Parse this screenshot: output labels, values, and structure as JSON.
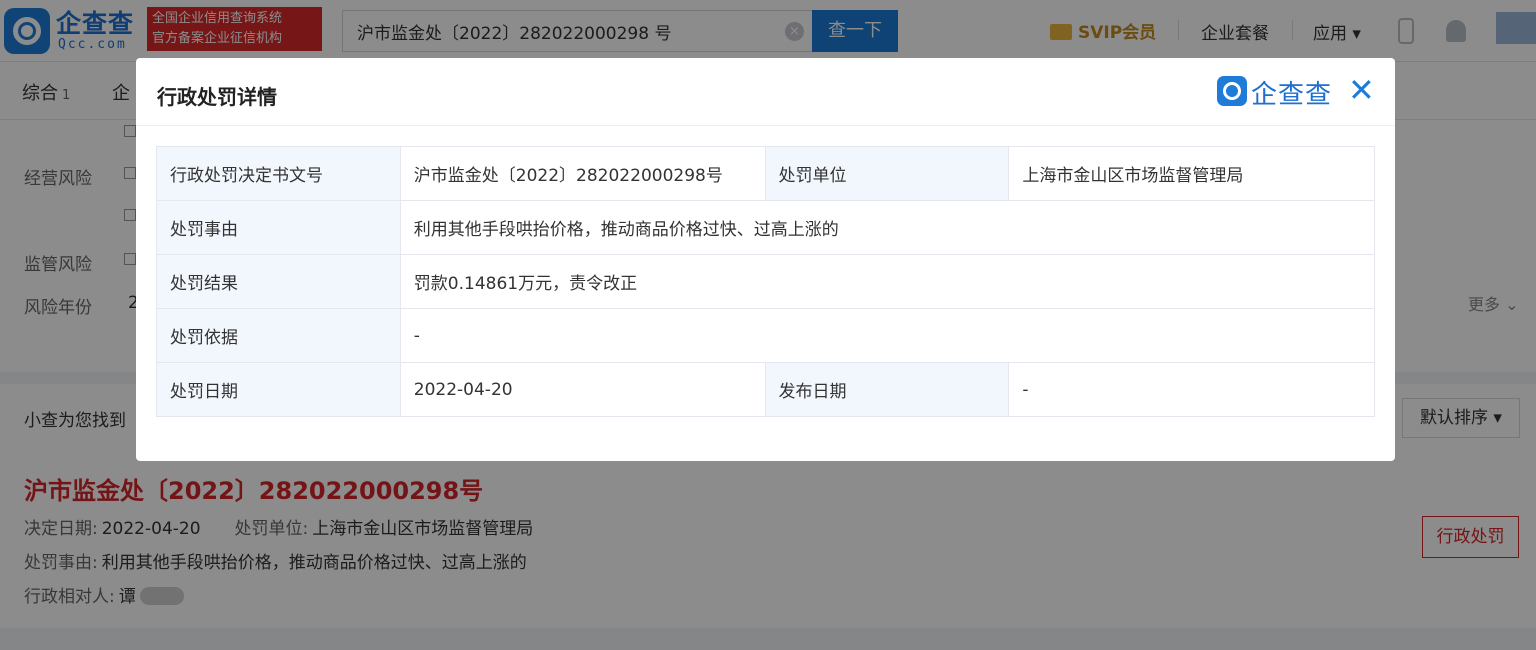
{
  "header": {
    "logo_text": "企查查",
    "logo_sub": "Qcc.com",
    "slogan_line1": "全国企业信用查询系统",
    "slogan_line2": "官方备案企业征信机构",
    "search_value": "沪市监金处〔2022〕282022000298 号",
    "search_button": "查一下",
    "svip": "SVIP会员",
    "nav": [
      "企业套餐",
      "应用 ▾"
    ]
  },
  "tabs": [
    {
      "label": "综合",
      "count": "1"
    },
    {
      "label": "企"
    }
  ],
  "filters": [
    "经营风险",
    "监管风险",
    "风险年份"
  ],
  "filter_year_partial": "2",
  "more_label": "更多 ⌄",
  "result_count": "小查为您找到",
  "sort_label": "默认排序 ▾",
  "result": {
    "title": "沪市监金处〔2022〕282022000298号",
    "decision_date_label": "决定日期:",
    "decision_date": "2022-04-20",
    "unit_label": "处罚单位:",
    "unit": "上海市金山区市场监督管理局",
    "reason_label": "处罚事由:",
    "reason": "利用其他手段哄抬价格，推动商品价格过快、过高上涨的",
    "party_label": "行政相对人:",
    "party": "谭",
    "tag": "行政处罚"
  },
  "modal": {
    "title": "行政处罚详情",
    "brand": "企查查",
    "close": "✕",
    "rows": {
      "doc_no_label": "行政处罚决定书文号",
      "doc_no": "沪市监金处〔2022〕282022000298号",
      "unit_label": "处罚单位",
      "unit": "上海市金山区市场监督管理局",
      "reason_label": "处罚事由",
      "reason": "利用其他手段哄抬价格，推动商品价格过快、过高上涨的",
      "result_label": "处罚结果",
      "result": "罚款0.14861万元，责令改正",
      "basis_label": "处罚依据",
      "basis": "-",
      "date_label": "处罚日期",
      "date": "2022-04-20",
      "publish_label": "发布日期",
      "publish": "-"
    }
  },
  "colors": {
    "brand_blue": "#1e7cd8",
    "accent_red": "#d3262b",
    "svip_gold": "#c48a1e"
  }
}
